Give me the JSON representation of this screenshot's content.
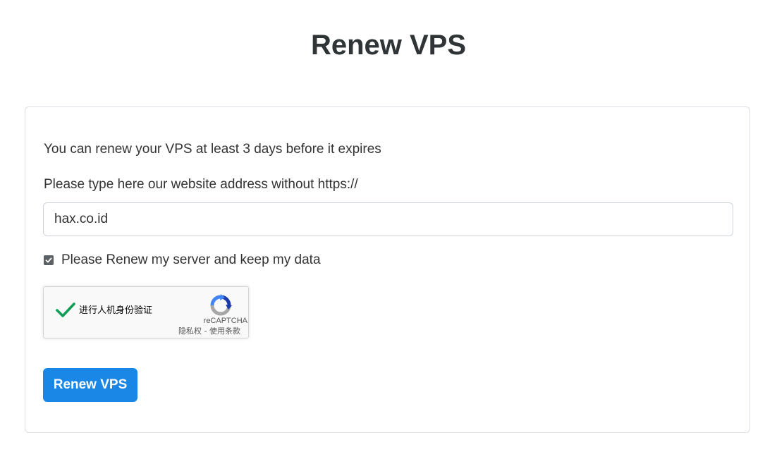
{
  "page": {
    "title": "Renew VPS"
  },
  "form": {
    "info_text": "You can renew your VPS at least 3 days before it expires",
    "address_label": "Please type here our website address without https://",
    "address_value": "hax.co.id",
    "renew_checkbox_label": "Please Renew my server and keep my data",
    "renew_checkbox_checked": true,
    "submit_label": "Renew VPS"
  },
  "recaptcha": {
    "status_text": "进行人机身份验证",
    "brand": "reCAPTCHA",
    "links": "隐私权 - 使用条款",
    "icons": [
      "checkmark-icon",
      "recaptcha-logo-icon"
    ]
  },
  "colors": {
    "accent": "#1a87e6",
    "check_green": "#0f9d58",
    "title": "#2f3437"
  }
}
